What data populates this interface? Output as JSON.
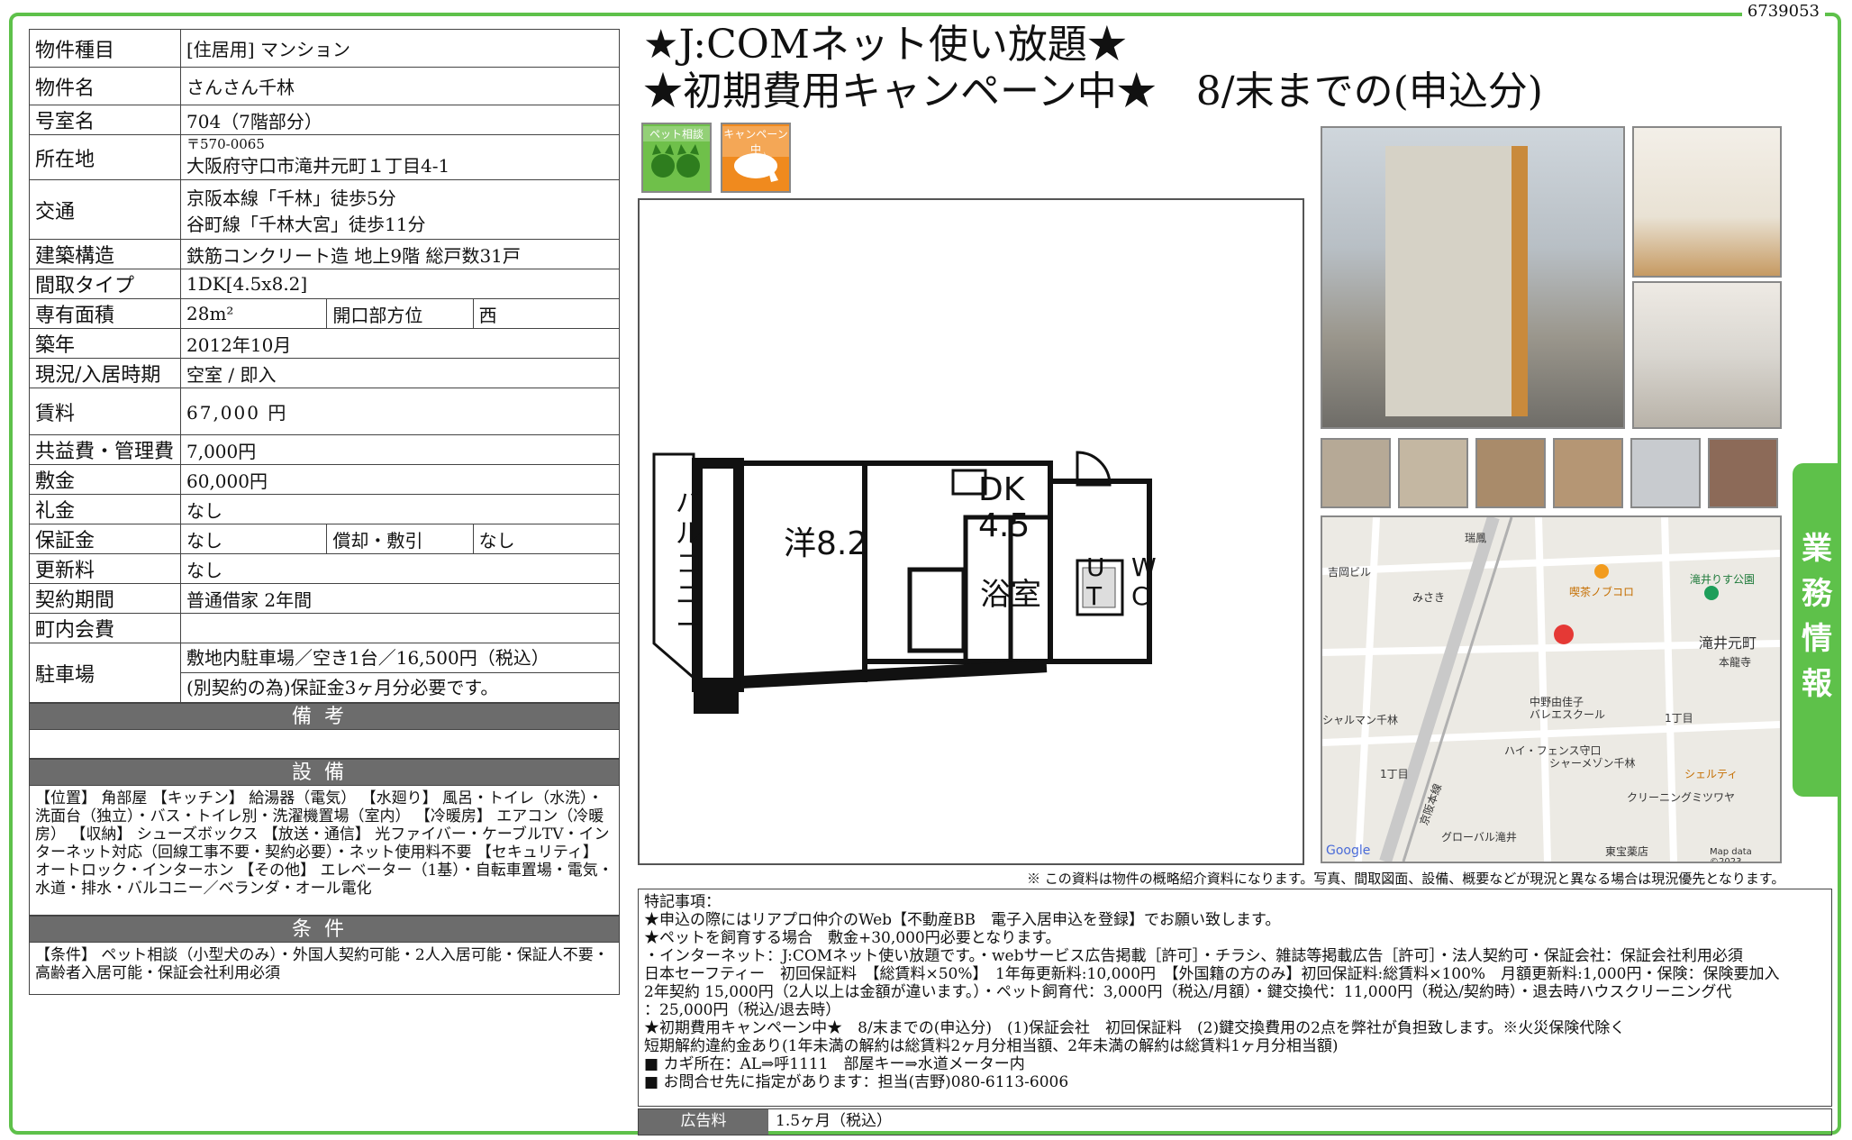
{
  "doc_id": "6739053",
  "spec": {
    "type_label": "物件種目",
    "type_value": "[住居用] マンション",
    "name_label": "物件名",
    "name_value": "さんさん千林",
    "room_label": "号室名",
    "room_value": "704（7階部分）",
    "addr_label": "所在地",
    "postal": "〒570-0065",
    "addr_value": "大阪府守口市滝井元町１丁目4-1",
    "access_label": "交通",
    "access_1": "京阪本線「千林」徒歩5分",
    "access_2": "谷町線「千林大宮」徒歩11分",
    "struct_label": "建築構造",
    "struct_value": "鉄筋コンクリート造 地上9階 総戸数31戸",
    "layout_label": "間取タイプ",
    "layout_value": "1DK[4.5x8.2]",
    "area_label": "専有面積",
    "area_value": "28m²",
    "dir_label": "開口部方位",
    "dir_value": "西",
    "built_label": "築年",
    "built_value": "2012年10月",
    "status_label": "現況/入居時期",
    "status_value": "空室 / 即入",
    "rent_label": "賃料",
    "rent_value": "67,000 円",
    "fee_label": "共益費・管理費",
    "fee_value": "7,000円",
    "deposit_label": "敷金",
    "deposit_value": "60,000円",
    "key_label": "礼金",
    "key_value": "なし",
    "guarantee_label": "保証金",
    "guarantee_value": "なし",
    "amort_label": "償却・敷引",
    "amort_value": "なし",
    "renew_label": "更新料",
    "renew_value": "なし",
    "contract_label": "契約期間",
    "contract_value": "普通借家 2年間",
    "assoc_label": "町内会費",
    "assoc_value": "",
    "parking_label": "駐車場",
    "parking_1": "敷地内駐車場／空き1台／16,500円（税込）",
    "parking_2": "(別契約の為)保証金3ヶ月分必要です。"
  },
  "sections": {
    "remarks_title": "備考",
    "equip_title": "設備",
    "equip_text": "【位置】 角部屋 【キッチン】 給湯器（電気） 【水廻り】 風呂・トイレ（水洗）・洗面台（独立）・バス・トイレ別・洗濯機置場（室内） 【冷暖房】 エアコン（冷暖房） 【収納】 シューズボックス 【放送・通信】 光ファイバー・ケーブルTV・インターネット対応（回線工事不要・契約必要）・ネット使用料不要 【セキュリティ】 オートロック・インターホン 【その他】 エレベーター（1基）・自転車置場・電気・水道・排水・バルコニー／ベランダ・オール電化",
    "cond_title": "条件",
    "cond_text": "【条件】 ペット相談（小型犬のみ）・外国人契約可能・2人入居可能・保証人不要・高齢者入居可能・保証会社利用必須"
  },
  "headline": {
    "line1": "★J:COMネット使い放題★",
    "line2": "★初期費用キャンペーン中★　8/末までの(申込分)"
  },
  "badges": {
    "pet": "ペット相談",
    "campaign": "キャンペーン中"
  },
  "floorplan": {
    "balcony": "バルコニー",
    "western": "洋8.2",
    "dk1": "DK",
    "dk2": "4.5",
    "bath": "浴室",
    "ut1": "U",
    "ut2": "T",
    "wc1": "W",
    "wc2": "C"
  },
  "map": {
    "labels": [
      "瑞鳳",
      "吉岡ビル",
      "みさき",
      "喫茶ノブコロ",
      "滝井りす公園",
      "滝井元町",
      "本龍寺",
      "中野由佳子",
      "バレエスクール",
      "シャルマン千林",
      "1丁目",
      "ハイ・フェンス守口",
      "シャーメゾン千林",
      "シェルティ",
      "クリーニングミツワヤ",
      "1丁目",
      "グローバル滝井",
      "東宝薬店",
      "京阪本線"
    ],
    "google": "Google",
    "mapdata": "Map data ©2023"
  },
  "disclaimer": "※ この資料は物件の概略紹介資料になります。写真、間取図面、設備、概要などが現況と異なる場合は現況優先となります。",
  "notes": [
    "特記事項：",
    "★申込の際にはリアプロ仲介のWeb【不動産BB　電子入居申込を登録】でお願い致します。",
    "★ペットを飼育する場合　敷金+30,000円必要となります。",
    "・インターネット：J:COMネット使い放題です。・webサービス広告掲載［許可］・チラシ、雑誌等掲載広告［許可］・法人契約可・保証会社：保証会社利用必須",
    "日本セーフティー　初回保証料　【総賃料×50%】　1年毎更新料:10,000円　【外国籍の方のみ】初回保証料:総賃料×100%　月額更新料:1,000円・保険：保険要加入",
    "2年契約 15,000円（2人以上は金額が違います。）・ペット飼育代：3,000円（税込/月額）・鍵交換代：11,000円（税込/契約時）・退去時ハウスクリーニング代",
    "：25,000円（税込/退去時）",
    "★初期費用キャンペーン中★　8/末までの(申込分)　(1)保証会社　初回保証料　(2)鍵交換費用の2点を弊社が負担致します。※火災保険代除く",
    "短期解約違約金あり(1年未満の解約は総賃料2ヶ月分相当額、2年未満の解約は総賃料1ヶ月分相当額)",
    "■ カギ所在：AL⇒呼1111　部屋キー⇒水道メーター内",
    "■ お問合せ先に指定があります：担当(吉野)080-6113-6006"
  ],
  "ad": {
    "label": "広告料",
    "value": "1.5ヶ月（税込）"
  },
  "side_tab": [
    "業",
    "務",
    "情",
    "報"
  ]
}
